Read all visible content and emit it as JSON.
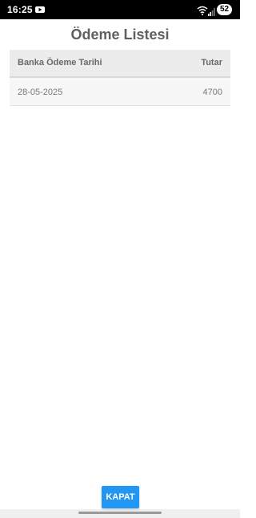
{
  "status_bar": {
    "time": "16:25",
    "battery": "52",
    "icons": [
      "youtube-icon",
      "wifi-icon",
      "signal-icon"
    ]
  },
  "page": {
    "title": "Ödeme Listesi"
  },
  "table": {
    "columns": [
      "Banka Ödeme Tarihi",
      "Tutar"
    ],
    "rows": [
      {
        "date": "28-05-2025",
        "amount": "4700"
      }
    ]
  },
  "actions": {
    "close_label": "KAPAT"
  },
  "colors": {
    "accent": "#2196f3",
    "title_text": "#5f5f5f",
    "header_bg": "#ececec"
  }
}
